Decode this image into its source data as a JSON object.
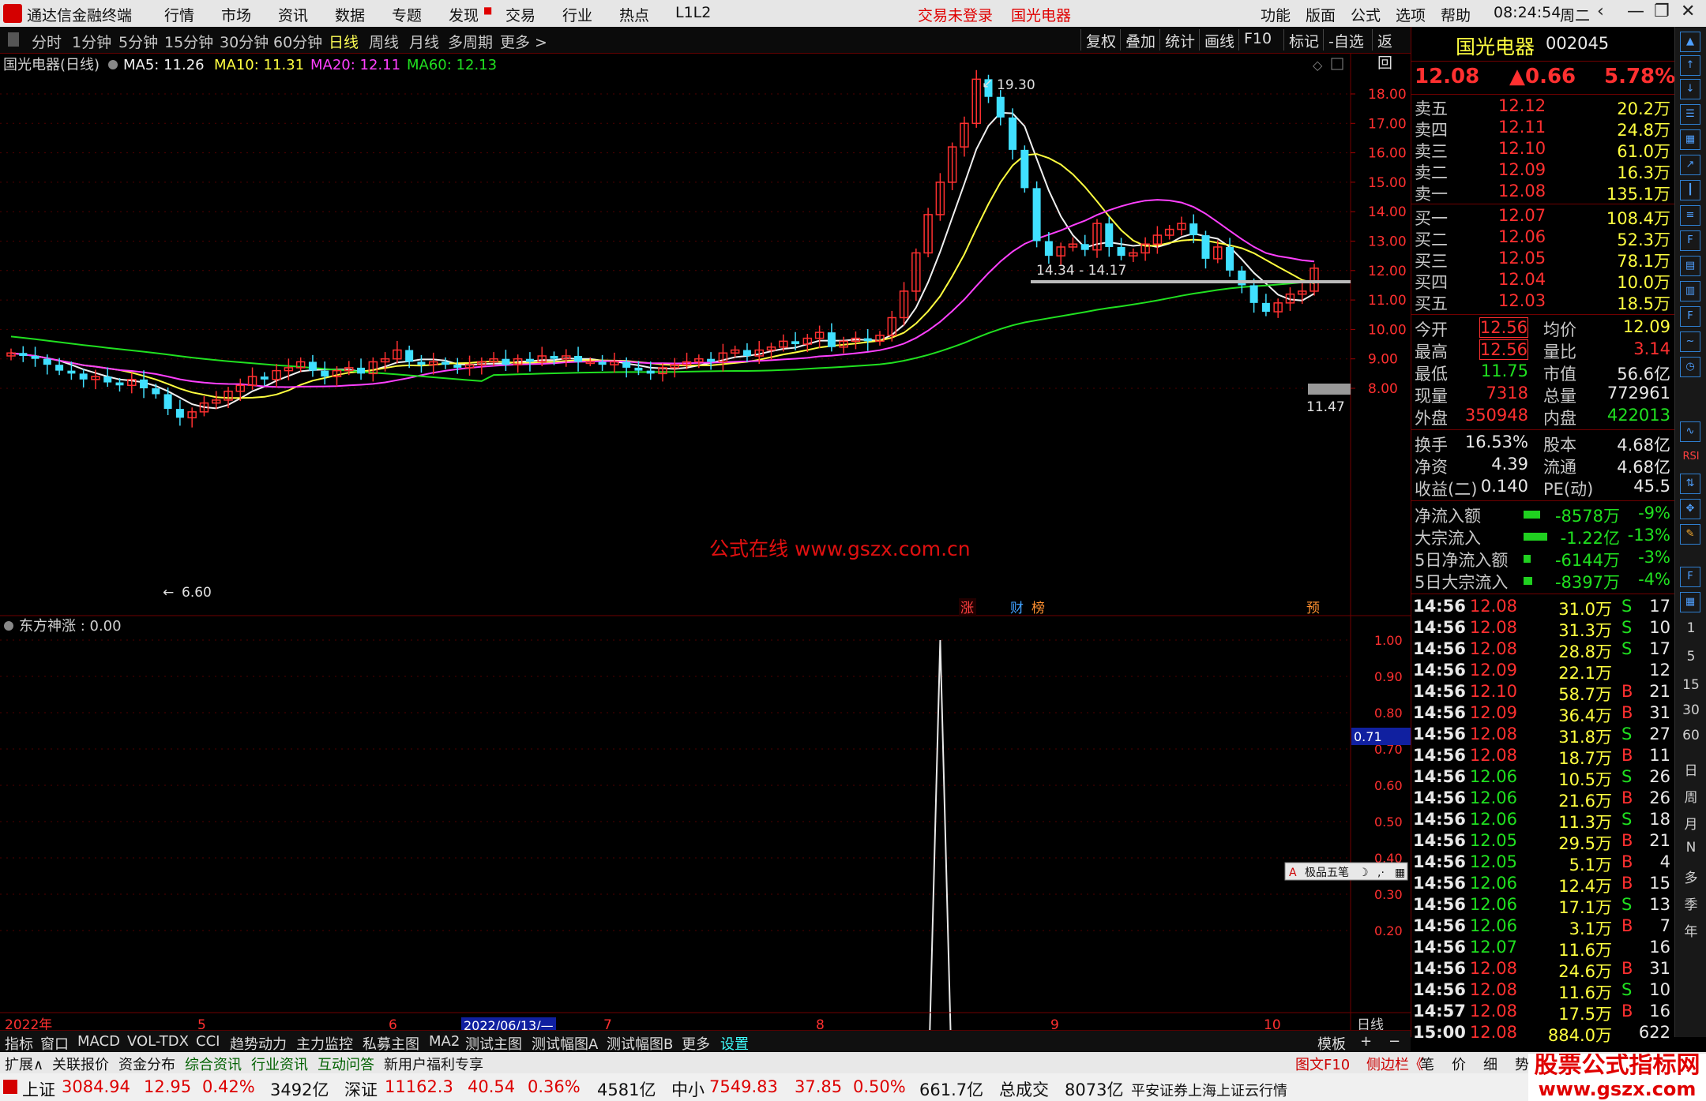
{
  "menubar": {
    "app_title": "通达信金融终端",
    "menus": [
      "行情",
      "市场",
      "资讯",
      "数据",
      "专题",
      "发现",
      "交易",
      "行业",
      "热点",
      "L1L2"
    ],
    "center_left": "交易未登录",
    "center_right": "国光电器",
    "right_menus": [
      "功能",
      "版面",
      "公式",
      "选项",
      "帮助"
    ],
    "time": "08:24:54",
    "weekday": "周二"
  },
  "toolbar": {
    "periods": [
      "分时",
      "1分钟",
      "5分钟",
      "15分钟",
      "30分钟",
      "60分钟",
      "日线",
      "周线",
      "月线",
      "多周期",
      "更多 >"
    ],
    "active": "日线",
    "right": [
      "复权",
      "叠加",
      "统计",
      "画线",
      "F10",
      "标记",
      "-自选",
      "返回"
    ]
  },
  "chart": {
    "legend": {
      "title": "国光电器(日线)",
      "ma5": "MA5: 11.26",
      "ma10": "MA10: 11.31",
      "ma20": "MA20: 12.11",
      "ma60": "MA60: 12.13"
    },
    "annotations": {
      "high": "19.30",
      "low": "6.60",
      "range": "14.34 - 14.17",
      "last": "11.47",
      "watermark": "公式在线  www.gszx.com.cn"
    },
    "event_tags": [
      "涨",
      "财",
      "榜",
      "预"
    ],
    "price_axis": [
      "18.00",
      "17.00",
      "16.00",
      "15.00",
      "14.00",
      "13.00",
      "12.00",
      "11.00",
      "10.00",
      "9.00",
      "8.00"
    ],
    "indicator": {
      "name": "东方神涨 : 0.00",
      "axis": [
        "1.00",
        "0.90",
        "0.80",
        "0.70",
        "0.60",
        "0.50",
        "0.40",
        "0.30",
        "0.20"
      ],
      "cursor_value": "0.71",
      "ime_bar": "极品五笔"
    },
    "date_axis": {
      "labels": [
        "2022年",
        "5",
        "6",
        "7",
        "8",
        "9",
        "10"
      ],
      "cursor_date": "2022/06/13/—",
      "period": "日线"
    }
  },
  "chart_data": {
    "type": "candlestick",
    "title": "国光电器(日线)",
    "ylim": [
      6.6,
      19.3
    ],
    "high": 19.3,
    "low": 6.6,
    "moving_averages": {
      "MA5": 11.26,
      "MA10": 11.31,
      "MA20": 12.11,
      "MA60": 12.13
    },
    "ohlc_close_approx": [
      9.2,
      9.1,
      9.0,
      8.8,
      8.6,
      8.5,
      8.3,
      8.4,
      8.2,
      8.1,
      8.3,
      8.0,
      7.8,
      7.3,
      7.0,
      7.2,
      7.5,
      7.6,
      7.9,
      8.1,
      8.4,
      8.3,
      8.6,
      8.7,
      8.9,
      8.6,
      8.4,
      8.6,
      8.7,
      8.5,
      8.9,
      9.0,
      9.3,
      8.9,
      8.8,
      8.9,
      8.8,
      8.7,
      8.8,
      8.9,
      9.0,
      8.8,
      9.0,
      8.9,
      9.1,
      9.0,
      9.1,
      8.9,
      8.9,
      8.8,
      8.9,
      8.7,
      8.6,
      8.5,
      8.7,
      8.8,
      8.9,
      9.0,
      8.9,
      9.2,
      9.3,
      9.1,
      9.3,
      9.4,
      9.6,
      9.5,
      9.7,
      9.9,
      9.4,
      9.6,
      9.7,
      9.6,
      9.8,
      10.4,
      11.3,
      12.6,
      13.9,
      15.0,
      16.2,
      17.0,
      18.5,
      17.9,
      17.2,
      16.1,
      14.8,
      13.0,
      12.5,
      12.8,
      12.9,
      12.7,
      13.6,
      12.8,
      12.5,
      12.6,
      12.9,
      13.2,
      13.4,
      13.6,
      13.2,
      12.4,
      12.8,
      12.0,
      11.5,
      10.9,
      10.6,
      10.9,
      11.2,
      11.3,
      12.08
    ],
    "indicator_series": {
      "name": "东方神涨",
      "spike_index": 77,
      "spike_value": 1.0,
      "last": 0.0
    }
  },
  "quote": {
    "name": "国光电器",
    "code": "002045",
    "price": "12.08",
    "change": "▲0.66",
    "pct": "5.78%",
    "asks": [
      {
        "label": "卖五",
        "price": "12.12",
        "vol": "20.2万"
      },
      {
        "label": "卖四",
        "price": "12.11",
        "vol": "24.8万"
      },
      {
        "label": "卖三",
        "price": "12.10",
        "vol": "61.0万"
      },
      {
        "label": "卖二",
        "price": "12.09",
        "vol": "16.3万"
      },
      {
        "label": "卖一",
        "price": "12.08",
        "vol": "135.1万"
      }
    ],
    "bids": [
      {
        "label": "买一",
        "price": "12.07",
        "vol": "108.4万"
      },
      {
        "label": "买二",
        "price": "12.06",
        "vol": "52.3万"
      },
      {
        "label": "买三",
        "price": "12.05",
        "vol": "78.1万"
      },
      {
        "label": "买四",
        "price": "12.04",
        "vol": "10.0万"
      },
      {
        "label": "买五",
        "price": "12.03",
        "vol": "18.5万"
      }
    ],
    "stats": [
      {
        "l1": "今开",
        "v1": "12.56",
        "l2": "均价",
        "v2": "12.09"
      },
      {
        "l1": "最高",
        "v1": "12.56",
        "l2": "量比",
        "v2": "3.14"
      },
      {
        "l1": "最低",
        "v1": "11.75",
        "l2": "市值",
        "v2": "56.6亿"
      },
      {
        "l1": "现量",
        "v1": "7318",
        "l2": "总量",
        "v2": "772961"
      },
      {
        "l1": "外盘",
        "v1": "350948",
        "l2": "内盘",
        "v2": "422013"
      }
    ],
    "stats2": [
      {
        "l1": "换手",
        "v1": "16.53%",
        "l2": "股本",
        "v2": "4.68亿"
      },
      {
        "l1": "净资",
        "v1": "4.39",
        "l2": "流通",
        "v2": "4.68亿"
      },
      {
        "l1": "收益(二)",
        "v1": "0.140",
        "l2": "PE(动)",
        "v2": "45.5"
      }
    ],
    "flows": [
      {
        "label": "净流入额",
        "value": "-8578万",
        "pct": "-9%",
        "bar": 0.35
      },
      {
        "label": "大宗流入",
        "value": "-1.22亿",
        "pct": "-13%",
        "bar": 0.5
      },
      {
        "label": "5日净流入额",
        "value": "-6144万",
        "pct": "-3%",
        "bar": 0.15
      },
      {
        "label": "5日大宗流入",
        "value": "-8397万",
        "pct": "-4%",
        "bar": 0.18
      }
    ],
    "ticks": [
      [
        "14:56",
        "12.08",
        "31.0万",
        "S",
        "17"
      ],
      [
        "14:56",
        "12.08",
        "31.3万",
        "S",
        "10"
      ],
      [
        "14:56",
        "12.08",
        "28.8万",
        "S",
        "17"
      ],
      [
        "14:56",
        "12.09",
        "22.1万",
        "",
        "12"
      ],
      [
        "14:56",
        "12.10",
        "58.7万",
        "B",
        "21"
      ],
      [
        "14:56",
        "12.09",
        "36.4万",
        "B",
        "31"
      ],
      [
        "14:56",
        "12.08",
        "31.8万",
        "S",
        "27"
      ],
      [
        "14:56",
        "12.08",
        "18.7万",
        "B",
        "11"
      ],
      [
        "14:56",
        "12.06",
        "10.5万",
        "S",
        "26"
      ],
      [
        "14:56",
        "12.06",
        "21.6万",
        "B",
        "26"
      ],
      [
        "14:56",
        "12.06",
        "11.3万",
        "S",
        "18"
      ],
      [
        "14:56",
        "12.05",
        "29.5万",
        "B",
        "21"
      ],
      [
        "14:56",
        "12.05",
        "5.1万",
        "B",
        "4"
      ],
      [
        "14:56",
        "12.06",
        "12.4万",
        "B",
        "15"
      ],
      [
        "14:56",
        "12.06",
        "17.1万",
        "S",
        "13"
      ],
      [
        "14:56",
        "12.06",
        "3.1万",
        "B",
        "7"
      ],
      [
        "14:56",
        "12.07",
        "11.6万",
        "",
        "16"
      ],
      [
        "14:56",
        "12.08",
        "24.6万",
        "B",
        "31"
      ],
      [
        "14:56",
        "12.08",
        "11.6万",
        "S",
        "10"
      ],
      [
        "14:57",
        "12.08",
        "17.5万",
        "B",
        "16"
      ],
      [
        "15:00",
        "12.08",
        "884.0万",
        "",
        "622"
      ]
    ]
  },
  "sidebar": {
    "text_items": [
      "1",
      "5",
      "15",
      "30",
      "60",
      "日",
      "周",
      "月",
      "N",
      "多",
      "季",
      "年"
    ],
    "rsi": "RSI"
  },
  "tabs1": {
    "items": [
      "指标",
      "窗口",
      "MACD",
      "VOL-TDX",
      "CCI",
      "趋势动力",
      "主力监控",
      "私募主图",
      "MA2",
      "测试主图",
      "测试幅图A",
      "测试幅图B",
      "更多",
      "设置"
    ],
    "active": "设置",
    "right": [
      "模板",
      "+",
      "−"
    ]
  },
  "tabs2": {
    "items": [
      "扩展∧",
      "关联报价",
      "资金分布",
      "综合资讯",
      "行业资讯",
      "互动问答",
      "新用户福利专享"
    ],
    "right": [
      "图文F10",
      "侧边栏《",
      "笔",
      "价",
      "细",
      "势"
    ]
  },
  "status": {
    "sh_label": "上证",
    "sh_val": "3084.94",
    "sh_chg": "12.95",
    "sh_pct": "0.42%",
    "sh_amt": "3492亿",
    "sz_label": "深证",
    "sz_val": "11162.3",
    "sz_chg": "40.54",
    "sz_pct": "0.36%",
    "sz_amt": "4581亿",
    "zx_label": "中小",
    "zx_val": "7549.83",
    "zx_chg": "37.85",
    "zx_pct": "0.50%",
    "zx_amt": "661.7亿",
    "total_label": "总成交",
    "total_val": "8073亿",
    "broker": "平安证券上海上证云行情"
  },
  "brand": {
    "line1": "股票公式指标网",
    "line2": "www.gszx.com"
  },
  "colors": {
    "up": "#ff3030",
    "down": "#40e0ff",
    "ma5": "#f0f0f0",
    "ma10": "#ffff40",
    "ma20": "#ff40ff",
    "ma60": "#20e020"
  }
}
